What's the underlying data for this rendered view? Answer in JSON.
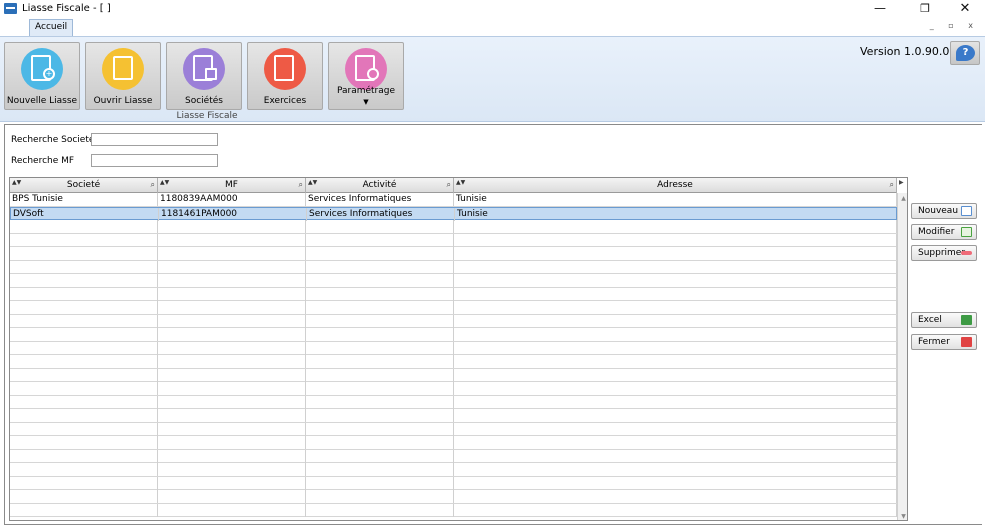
{
  "window": {
    "title": "Liasse Fiscale - [ ]",
    "minimize": "—",
    "maximize": "❐",
    "close": "✕"
  },
  "ribbon": {
    "tab": "Accueil",
    "mdi_controls": "_ ▫ x",
    "group_label": "Liasse Fiscale",
    "buttons": [
      {
        "label": "Nouvelle Liasse",
        "icon": "new-document-icon",
        "color": "#4cb8e6"
      },
      {
        "label": "Ouvrir Liasse",
        "icon": "open-document-icon",
        "color": "#f5c132"
      },
      {
        "label": "Sociétés",
        "icon": "company-document-icon",
        "color": "#9b7fd8"
      },
      {
        "label": "Exercices",
        "icon": "exercise-document-icon",
        "color": "#ee5a45"
      },
      {
        "label": "Paramétrage",
        "icon": "settings-document-icon",
        "color": "#e276b9"
      }
    ],
    "version": "Version 1.0.90.0",
    "help_glyph": "?"
  },
  "search": {
    "societe_label": "Recherche Societé",
    "societe_value": "",
    "mf_label": "Recherche MF",
    "mf_value": ""
  },
  "grid": {
    "columns": [
      "Societé",
      "MF",
      "Activité",
      "Adresse"
    ],
    "rows": [
      [
        "BPS Tunisie",
        "1180839AAM000",
        "Services Informatiques",
        "Tunisie"
      ],
      [
        "DVSoft",
        "1181461PAM000",
        "Services Informatiques",
        "Tunisie"
      ]
    ],
    "selected_row": 1
  },
  "actions": {
    "nouveau": "Nouveau",
    "modifier": "Modifier",
    "supprimer": "Supprimer",
    "excel": "Excel",
    "fermer": "Fermer"
  }
}
